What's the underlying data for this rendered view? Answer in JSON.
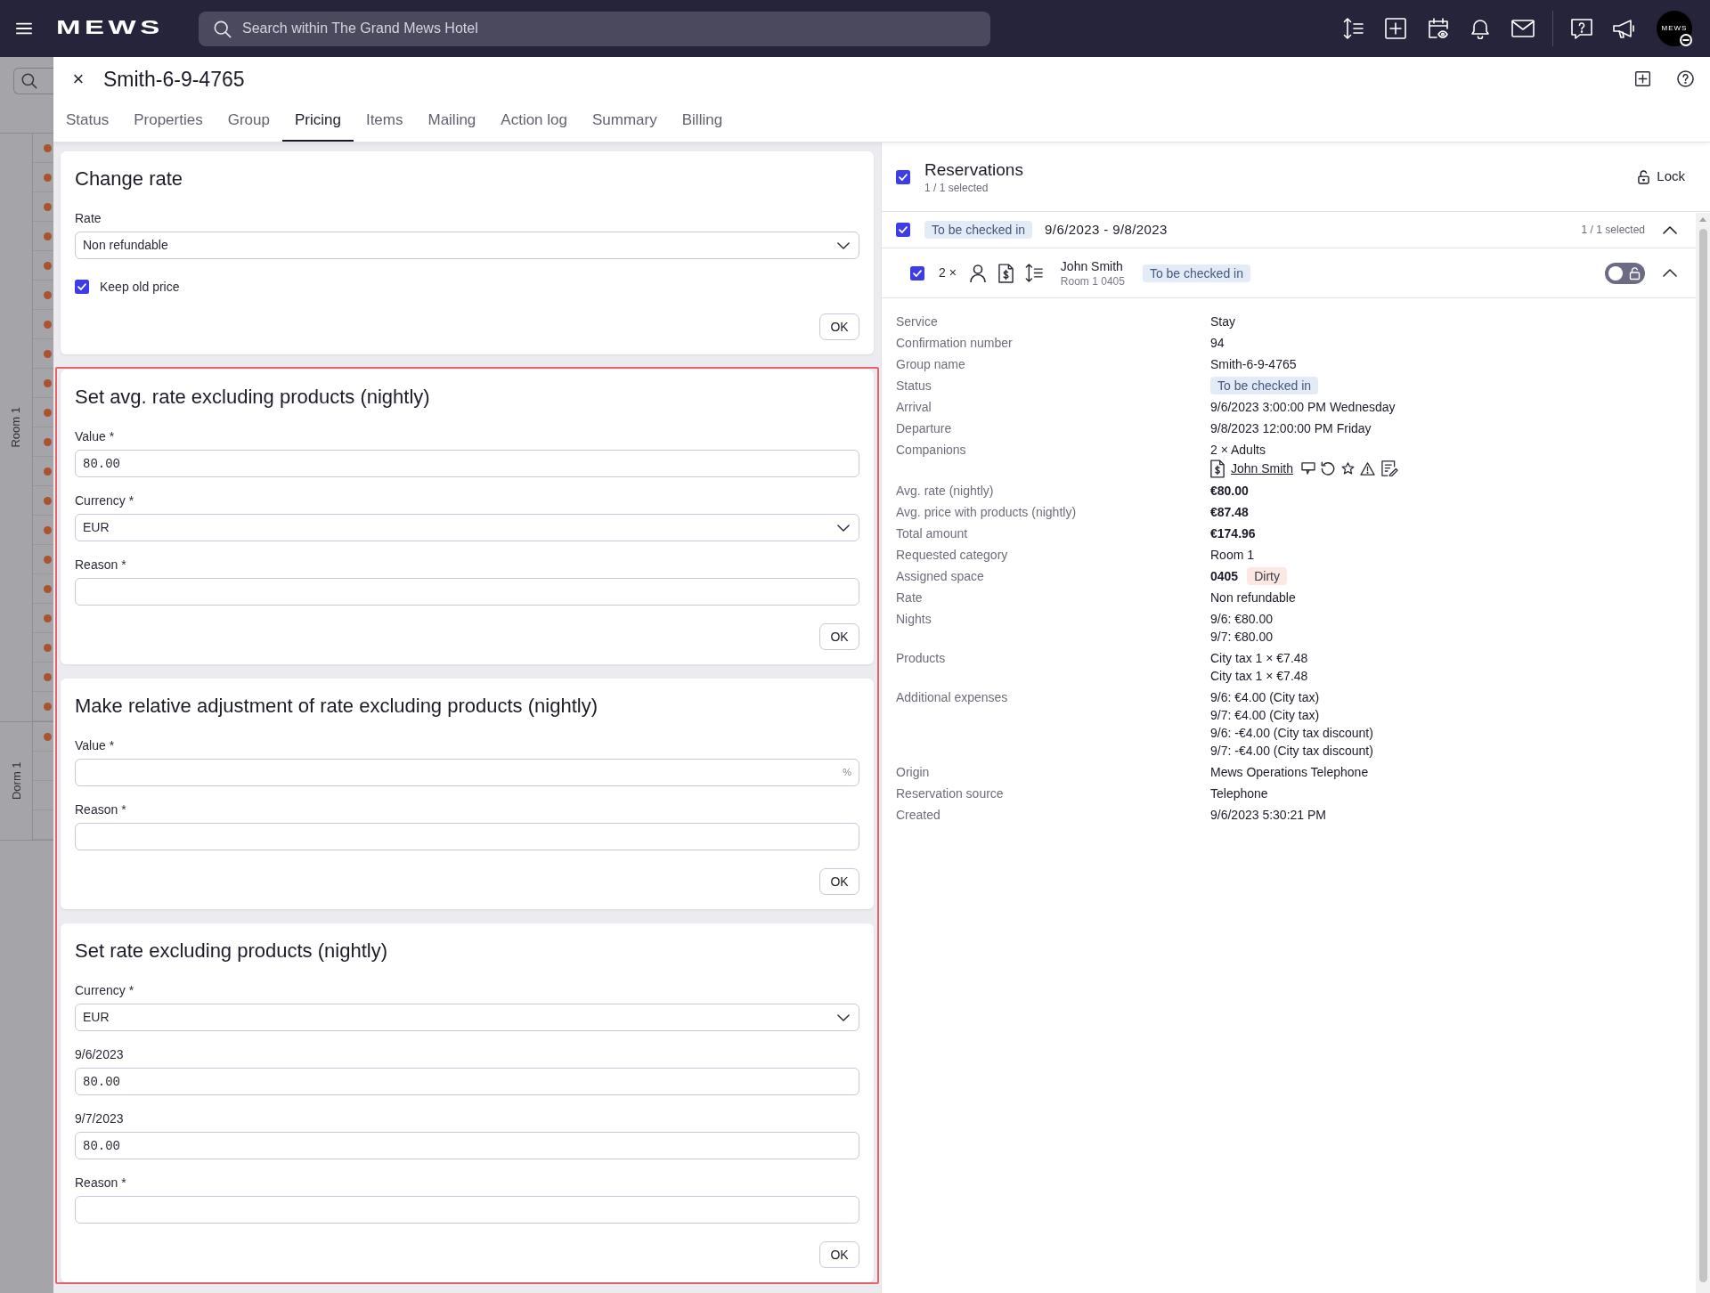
{
  "top_bar": {
    "logo": "MEWS",
    "search": {
      "placeholder": "Search within The Grand Mews Hotel"
    },
    "avatar": {
      "text": "MEWS"
    }
  },
  "background_timeline": {
    "groups": [
      {
        "label": "Room 1",
        "rows": [
          {
            "booked": true
          },
          {
            "booked": true
          },
          {
            "booked": true
          },
          {
            "booked": true
          },
          {
            "booked": true
          },
          {
            "booked": true
          },
          {
            "booked": true
          },
          {
            "booked": true
          },
          {
            "booked": true
          },
          {
            "booked": true
          },
          {
            "booked": true
          },
          {
            "booked": true
          },
          {
            "booked": true
          },
          {
            "booked": true
          },
          {
            "booked": true
          },
          {
            "booked": true
          },
          {
            "booked": true
          },
          {
            "booked": true
          },
          {
            "booked": true
          },
          {
            "booked": true
          }
        ]
      },
      {
        "label": "Dorm 1",
        "rows": [
          {
            "booked": true
          },
          {
            "booked": false
          },
          {
            "booked": false
          },
          {
            "booked": false
          }
        ]
      }
    ]
  },
  "reservation_dialog": {
    "close": "×",
    "title": "Smith-6-9-4765",
    "tabs": [
      {
        "label": "Status",
        "selected": false
      },
      {
        "label": "Properties",
        "selected": false
      },
      {
        "label": "Group",
        "selected": false
      },
      {
        "label": "Pricing",
        "selected": true
      },
      {
        "label": "Items",
        "selected": false
      },
      {
        "label": "Mailing",
        "selected": false
      },
      {
        "label": "Action log",
        "selected": false
      },
      {
        "label": "Summary",
        "selected": false
      },
      {
        "label": "Billing",
        "selected": false
      }
    ]
  },
  "pricing_forms": [
    {
      "title": "Change rate",
      "highlighted": false,
      "fields": [
        {
          "kind": "select",
          "label": "Rate",
          "value": "Non refundable"
        },
        {
          "kind": "checkbox",
          "label": "Keep old price",
          "checked": true
        }
      ],
      "button": "OK"
    },
    {
      "title": "Set avg. rate excluding products (nightly)",
      "highlighted": true,
      "fields": [
        {
          "kind": "input",
          "label": "Value *",
          "value": "80.00"
        },
        {
          "kind": "select",
          "label": "Currency *",
          "value": "EUR"
        },
        {
          "kind": "input",
          "label": "Reason *"
        }
      ],
      "button": "OK"
    },
    {
      "title": "Make relative adjustment of rate excluding products (nightly)",
      "highlighted": true,
      "fields": [
        {
          "kind": "input",
          "label": "Value *",
          "suffix": "%"
        },
        {
          "kind": "input",
          "label": "Reason *"
        }
      ],
      "button": "OK"
    },
    {
      "title": "Set rate excluding products (nightly)",
      "highlighted": true,
      "fields": [
        {
          "kind": "select",
          "label": "Currency *",
          "value": "EUR"
        },
        {
          "kind": "input",
          "label": "9/6/2023",
          "value": "80.00"
        },
        {
          "kind": "input",
          "label": "9/7/2023",
          "value": "80.00"
        },
        {
          "kind": "input",
          "label": "Reason *"
        }
      ],
      "button": "OK"
    }
  ],
  "reservations": {
    "checked": true,
    "title": "Reservations",
    "selection": "1 / 1 selected",
    "lock": "Lock",
    "group": {
      "checked": true,
      "status": {
        "text": "To be checked in",
        "color": "#e3ebf6"
      },
      "dates": "9/6/2023 - 9/8/2023",
      "selection": "1 / 1 selected",
      "expanded": true
    },
    "reservation": {
      "checked": true,
      "guests": "2 ×",
      "name": "John Smith",
      "room": "Room 1 0405",
      "status": {
        "text": "To be checked in",
        "color": "#e3ebf6"
      },
      "locked": false,
      "expanded": true
    },
    "details": [
      {
        "label": "Service",
        "lines": [
          {
            "kind": "text",
            "text": "Stay"
          }
        ]
      },
      {
        "label": "Confirmation number",
        "lines": [
          {
            "kind": "text",
            "text": "94"
          }
        ]
      },
      {
        "label": "Group name",
        "lines": [
          {
            "kind": "text",
            "text": "Smith-6-9-4765"
          }
        ]
      },
      {
        "label": "Status",
        "lines": [
          {
            "kind": "badge",
            "text": "To be checked in",
            "color": "#e3ebf6"
          }
        ]
      },
      {
        "label": "Arrival",
        "lines": [
          {
            "kind": "text",
            "text": "9/6/2023 3:00:00 PM Wednesday"
          }
        ]
      },
      {
        "label": "Departure",
        "lines": [
          {
            "kind": "text",
            "text": "9/8/2023 12:00:00 PM Friday"
          }
        ]
      },
      {
        "label": "Companions",
        "lines": [
          {
            "kind": "text",
            "text": "2 × Adults"
          },
          {
            "kind": "guest",
            "text": "John Smith"
          }
        ]
      },
      {
        "label": "Avg. rate (nightly)",
        "lines": [
          {
            "kind": "strong",
            "text": "€80.00"
          }
        ]
      },
      {
        "label": "Avg. price with products (nightly)",
        "lines": [
          {
            "kind": "strong",
            "text": "€87.48"
          }
        ]
      },
      {
        "label": "Total amount",
        "lines": [
          {
            "kind": "strong",
            "text": "€174.96"
          }
        ]
      },
      {
        "label": "Requested category",
        "lines": [
          {
            "kind": "text",
            "text": "Room 1"
          }
        ]
      },
      {
        "label": "Assigned space",
        "lines": [
          {
            "kind": "space",
            "text": "0405",
            "badge": "Dirty",
            "color": "#fbe8e2"
          }
        ]
      },
      {
        "label": "Rate",
        "lines": [
          {
            "kind": "text",
            "text": "Non refundable"
          }
        ]
      },
      {
        "label": "Nights",
        "lines": [
          {
            "kind": "text",
            "text": "9/6: €80.00"
          },
          {
            "kind": "text",
            "text": "9/7: €80.00"
          }
        ]
      },
      {
        "label": "Products",
        "lines": [
          {
            "kind": "text",
            "text": "City tax 1 × €7.48"
          },
          {
            "kind": "text",
            "text": "City tax 1 × €7.48"
          }
        ]
      },
      {
        "label": "Additional expenses",
        "lines": [
          {
            "kind": "text",
            "text": "9/6: €4.00 (City tax)"
          },
          {
            "kind": "text",
            "text": "9/7: €4.00 (City tax)"
          },
          {
            "kind": "text",
            "text": "9/6: -€4.00 (City tax discount)"
          },
          {
            "kind": "text",
            "text": "9/7: -€4.00 (City tax discount)"
          }
        ]
      },
      {
        "label": "Origin",
        "lines": [
          {
            "kind": "text",
            "text": "Mews Operations Telephone"
          }
        ]
      },
      {
        "label": "Reservation source",
        "lines": [
          {
            "kind": "text",
            "text": "Telephone"
          }
        ]
      },
      {
        "label": "Created",
        "lines": [
          {
            "kind": "text",
            "text": "9/6/2023 5:30:21 PM"
          }
        ]
      }
    ]
  }
}
